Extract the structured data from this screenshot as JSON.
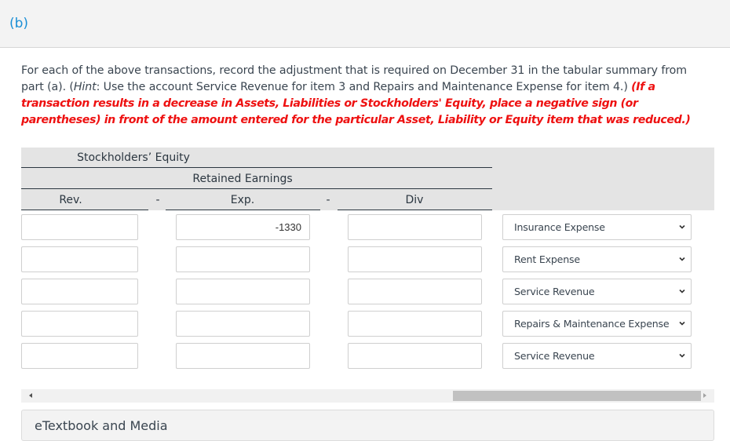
{
  "part": {
    "label": "(b)"
  },
  "instructions": {
    "text_1": "For each of the above transactions, record the adjustment that is required on December 31 in the tabular summary from part (a). (",
    "hint_label": "Hint",
    "text_2": ": Use the account Service Revenue for item 3 and Repairs and Maintenance Expense for item 4.) ",
    "warning": "(If a transaction results in a decrease in Assets, Liabilities or Stockholders' Equity, place a negative sign (or parentheses) in front of the amount entered for the particular Asset, Liability or Equity item that was reduced.)"
  },
  "table": {
    "group_header": "Stockholders’ Equity",
    "sub_header": "Retained Earnings",
    "columns": {
      "rev": "Rev.",
      "minus_1": "-",
      "exp": "Exp.",
      "minus_2": "-",
      "div": "Div"
    },
    "rows": [
      {
        "rev": "",
        "exp": "-1330",
        "div": "",
        "account": "Insurance Expense"
      },
      {
        "rev": "",
        "exp": "",
        "div": "",
        "account": "Rent Expense"
      },
      {
        "rev": "",
        "exp": "",
        "div": "",
        "account": "Service Revenue"
      },
      {
        "rev": "",
        "exp": "",
        "div": "",
        "account": "Repairs & Maintenance Expense"
      },
      {
        "rev": "",
        "exp": "",
        "div": "",
        "account": "Service Revenue"
      }
    ]
  },
  "footer": {
    "etextbook_label": "eTextbook and Media"
  },
  "colors": {
    "accent": "#1a8fd6",
    "warning": "#ee1111"
  }
}
